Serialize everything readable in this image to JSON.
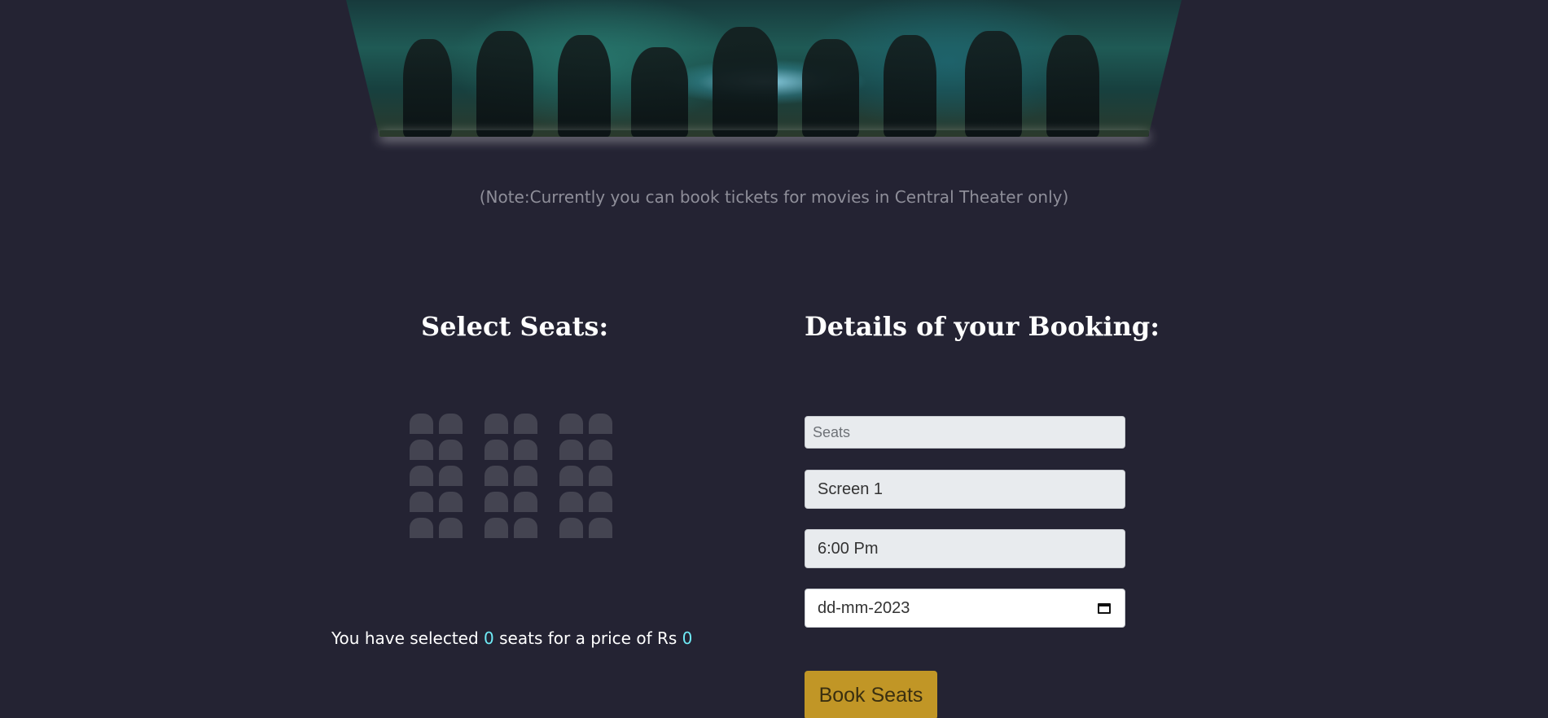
{
  "banner": {
    "image_name": "movie-poster-image"
  },
  "note": "(Note:Currently you can book tickets for movies in Central Theater only)",
  "seat_section": {
    "heading": "Select Seats:",
    "rows": 5,
    "groups": 3,
    "seats_per_group": 2,
    "summary_prefix": "You have selected ",
    "selected_count": "0",
    "summary_middle": " seats for a price of Rs ",
    "price": "0"
  },
  "booking": {
    "heading": "Details of your Booking:",
    "seats_placeholder": "Seats",
    "screen_value": "Screen 1",
    "time_value": "6:00 Pm",
    "date_value": "dd-mm-2023",
    "book_label": "Book Seats"
  },
  "colors": {
    "background": "#242333",
    "seat": "#444451",
    "highlight": "#6feaf6",
    "button": "#c19626"
  }
}
